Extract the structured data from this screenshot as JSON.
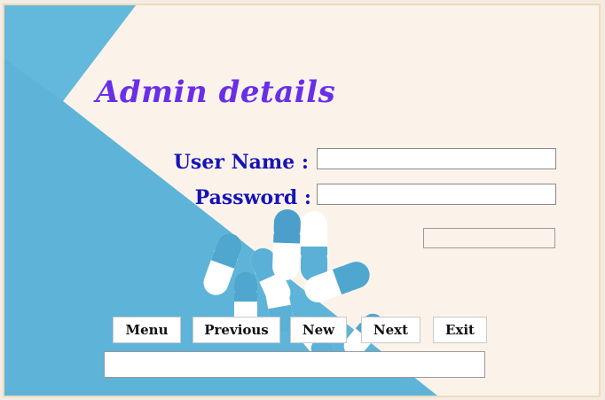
{
  "title": "Admin details",
  "form": {
    "username_label": "User Name :",
    "password_label": "Password :",
    "username_value": "",
    "password_value": "",
    "extra_value": ""
  },
  "buttons": {
    "menu": "Menu",
    "previous": "Previous",
    "new": "New",
    "next": "Next",
    "exit": "Exit"
  },
  "status_text": "",
  "colors": {
    "title": "#6a2ee8",
    "label": "#1713b8",
    "background_blue": "#5db4d8",
    "background_cream": "#fbf3ea",
    "frame_border": "#f1d9bb"
  },
  "background_image": "pills-capsules-photo"
}
